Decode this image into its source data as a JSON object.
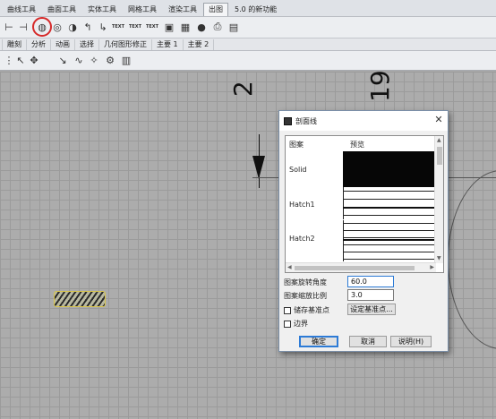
{
  "ribbon": {
    "tabs": [
      {
        "label": "曲线工具",
        "active": false
      },
      {
        "label": "曲面工具",
        "active": false
      },
      {
        "label": "实体工具",
        "active": false
      },
      {
        "label": "网格工具",
        "active": false
      },
      {
        "label": "渲染工具",
        "active": false
      },
      {
        "label": "出图",
        "active": true
      },
      {
        "label": "5.0 的新功能",
        "active": false
      }
    ],
    "toolbar_text_icons": [
      "TEXT",
      "TEXT",
      "TEXT"
    ],
    "sub_tabs": [
      "雕刻",
      "分析",
      "动画",
      "选择",
      "几何图形修正",
      "主要 1",
      "主要 2"
    ]
  },
  "viewport": {
    "dimension_values": [
      "2",
      "19"
    ]
  },
  "hatch_dialog": {
    "title": "剖面线",
    "close_label": "✕",
    "list": {
      "col_pattern": "图案",
      "col_preview": "预览",
      "items": [
        "Solid",
        "Hatch1",
        "Hatch2"
      ]
    },
    "rotation": {
      "label": "图案旋转角度",
      "value": "60.0"
    },
    "scale": {
      "label": "图案缩放比例",
      "value": "3.0"
    },
    "store_base_point": {
      "label": "储存基准点",
      "checked": false
    },
    "set_base_point_label": "设定基准点...",
    "boundary": {
      "label": "边界",
      "checked": false
    },
    "buttons": {
      "ok": "确定",
      "cancel": "取消",
      "help": "说明(H)"
    }
  },
  "colors": {
    "highlight_circle": "#d62a2a",
    "viewport_bg": "#acacac",
    "focus_blue": "#2d7bd6"
  }
}
